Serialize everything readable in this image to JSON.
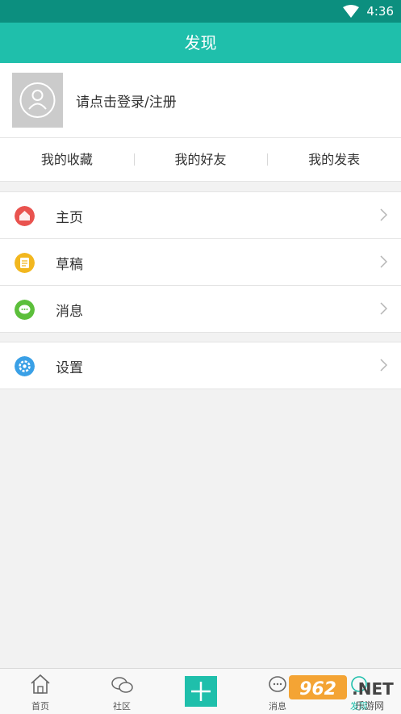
{
  "status_bar": {
    "time": "4:36"
  },
  "header": {
    "title": "发现"
  },
  "profile": {
    "login_prompt": "请点击登录/注册"
  },
  "tabs": [
    {
      "label": "我的收藏"
    },
    {
      "label": "我的好友"
    },
    {
      "label": "我的发表"
    }
  ],
  "menu": {
    "group1": [
      {
        "label": "主页",
        "icon": "home-icon",
        "color": "#e9534f"
      },
      {
        "label": "草稿",
        "icon": "draft-icon",
        "color": "#f2b71f"
      },
      {
        "label": "消息",
        "icon": "message-icon",
        "color": "#5cbf3b"
      }
    ],
    "group2": [
      {
        "label": "设置",
        "icon": "settings-icon",
        "color": "#3aa0e6"
      }
    ]
  },
  "bottom_nav": [
    {
      "label": "首页",
      "icon": "home-outline-icon"
    },
    {
      "label": "社区",
      "icon": "community-icon"
    },
    {
      "label": "",
      "icon": "add-icon"
    },
    {
      "label": "消息",
      "icon": "chat-icon"
    },
    {
      "label": "发现",
      "icon": "discover-icon"
    }
  ],
  "watermark": {
    "text": "962.NET",
    "subtext": "乐游网"
  },
  "colors": {
    "primary": "#1fbfab",
    "status_bar": "#0c8f7f"
  }
}
